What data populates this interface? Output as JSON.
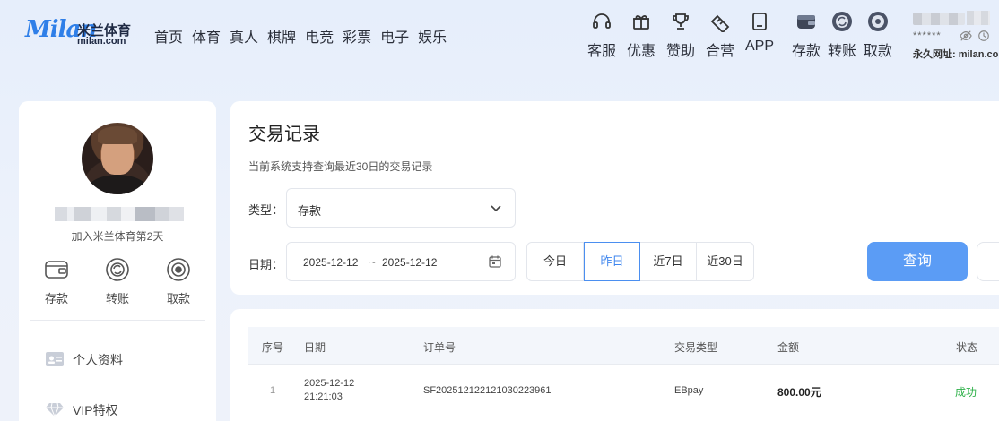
{
  "brand": {
    "script": "Milan",
    "cn": "米兰体育",
    "en": "milan.com"
  },
  "nav": [
    "首页",
    "体育",
    "真人",
    "棋牌",
    "电竞",
    "彩票",
    "电子",
    "娱乐"
  ],
  "header_icons": {
    "service": "客服",
    "promo": "优惠",
    "sponsor": "赞助",
    "partner": "合营",
    "app": "APP",
    "deposit": "存款",
    "transfer": "转账",
    "withdraw": "取款"
  },
  "account": {
    "masked": "******",
    "permalink": "永久网址: milan.com"
  },
  "sidebar": {
    "join_text": "加入米兰体育第2天",
    "actions": {
      "deposit": "存款",
      "transfer": "转账",
      "withdraw": "取款"
    },
    "menu": [
      {
        "label": "个人资料",
        "icon": "id-card-icon"
      },
      {
        "label": "VIP特权",
        "icon": "diamond-icon"
      }
    ]
  },
  "filter": {
    "title": "交易记录",
    "subtitle": "当前系统支持查询最近30日的交易记录",
    "type_label": "类型：",
    "type_value": "存款",
    "date_label": "日期：",
    "date_start": "2025-12-12",
    "date_sep": "~",
    "date_end": "2025-12-12",
    "quick": [
      "今日",
      "昨日",
      "近7日",
      "近30日"
    ],
    "quick_active": "昨日",
    "query_button": "查询"
  },
  "table": {
    "headers": [
      "序号",
      "日期",
      "订单号",
      "交易类型",
      "金额",
      "状态"
    ],
    "rows": [
      {
        "index": "1",
        "date": "2025-12-12",
        "time": "21:21:03",
        "order": "SF202512122121030223961",
        "type": "EBpay",
        "amount": "800.00元",
        "status": "成功"
      }
    ]
  },
  "colors": {
    "accent": "#5b9cf5",
    "brand": "#2f7fe8",
    "success": "#2fb14a"
  }
}
